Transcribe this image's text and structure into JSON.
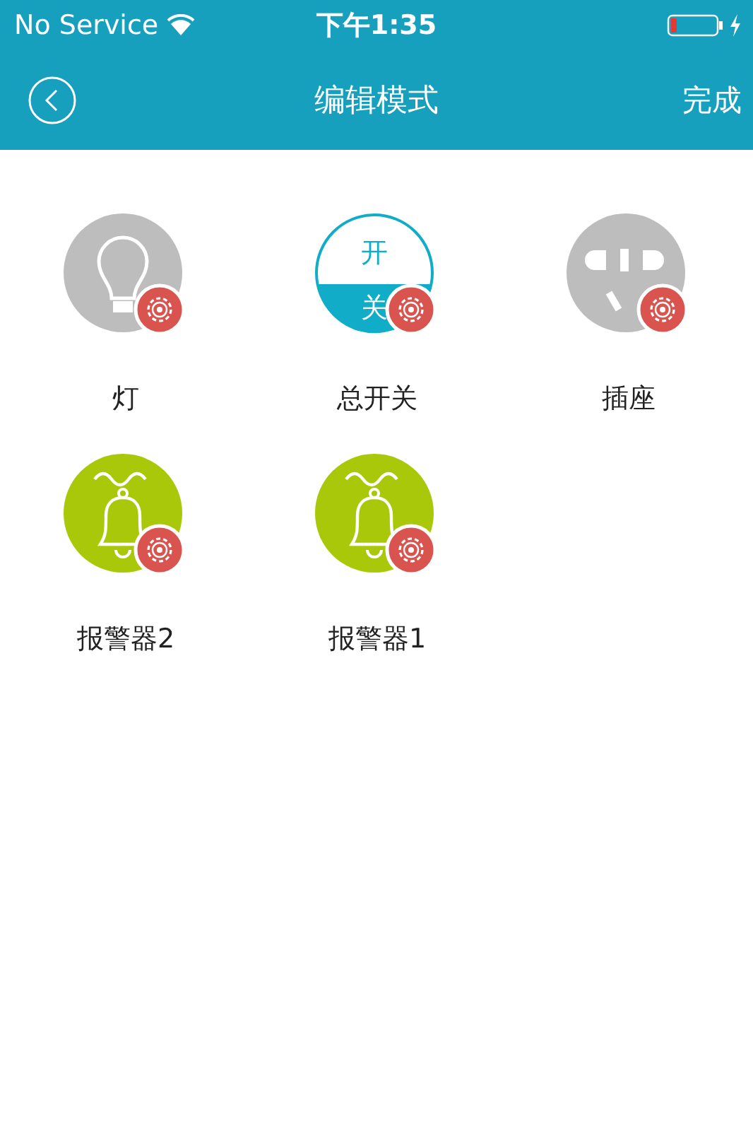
{
  "status_bar": {
    "carrier": "No Service",
    "time": "下午1:35"
  },
  "nav_bar": {
    "title": "编辑模式",
    "done": "完成"
  },
  "devices": [
    {
      "kind": "light",
      "label": "灯"
    },
    {
      "kind": "switch",
      "label": "总开关",
      "on_text": "开",
      "off_text": "关"
    },
    {
      "kind": "socket",
      "label": "插座"
    },
    {
      "kind": "alarm",
      "label": "报警器2"
    },
    {
      "kind": "alarm",
      "label": "报警器1"
    }
  ]
}
